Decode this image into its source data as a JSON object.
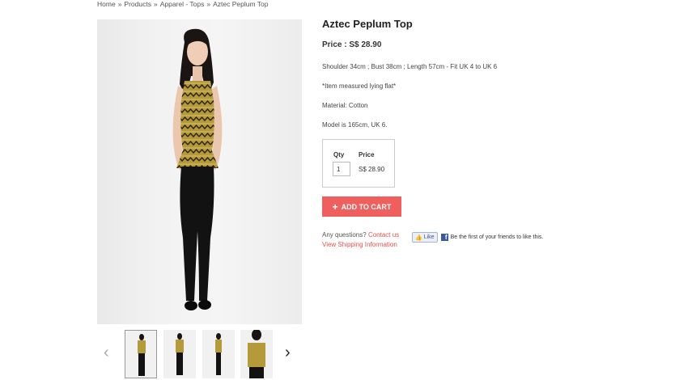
{
  "breadcrumb": {
    "items": [
      "Home",
      "Products",
      "Apparel - Tops",
      "Aztec Peplum Top"
    ],
    "separator": "»"
  },
  "product": {
    "title": "Aztec Peplum Top",
    "price_line": "Price : S$ 28.90",
    "description": [
      "Shoulder 34cm ; Bust 38cm ; Length 57cm - Fit UK 4 to UK 6",
      "*Item measured lying flat*",
      "Material: Cotton",
      "Model is 165cm, UK 6."
    ]
  },
  "order_box": {
    "qty_label": "Qty",
    "price_label": "Price",
    "qty_value": "1",
    "price_value": "S$ 28.90"
  },
  "cart_button": {
    "icon": "plus-icon",
    "label": "ADD TO CART",
    "color": "#ef5f5e"
  },
  "support": {
    "question_text": "Any questions?",
    "contact_link": "Contact us",
    "shipping_link": "View Shipping Information"
  },
  "facebook": {
    "like_label": "Like",
    "social_text": "Be the first of your friends to like this."
  },
  "gallery": {
    "prev_icon": "chevron-left-icon",
    "next_icon": "chevron-right-icon",
    "thumbnails": [
      {
        "name": "thumbnail-front",
        "active": true
      },
      {
        "name": "thumbnail-front-alt",
        "active": false
      },
      {
        "name": "thumbnail-side",
        "active": false
      },
      {
        "name": "thumbnail-closeup",
        "active": false
      }
    ]
  }
}
